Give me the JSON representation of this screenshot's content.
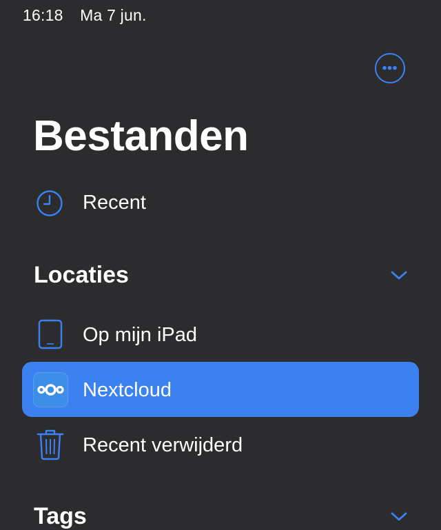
{
  "status_bar": {
    "time": "16:18",
    "date": "Ma 7 jun."
  },
  "header": {
    "title": "Bestanden",
    "more_icon": "ellipsis-circle-icon"
  },
  "recent": {
    "label": "Recent",
    "icon": "clock-icon"
  },
  "locations": {
    "title": "Locaties",
    "items": [
      {
        "label": "Op mijn iPad",
        "icon": "ipad-icon"
      },
      {
        "label": "Nextcloud",
        "icon": "nextcloud-icon",
        "selected": true
      },
      {
        "label": "Recent verwijderd",
        "icon": "trash-icon"
      }
    ]
  },
  "tags": {
    "title": "Tags"
  },
  "colors": {
    "background": "#2c2c2e",
    "accent": "#3b82f6",
    "selected": "#3b82f0"
  }
}
